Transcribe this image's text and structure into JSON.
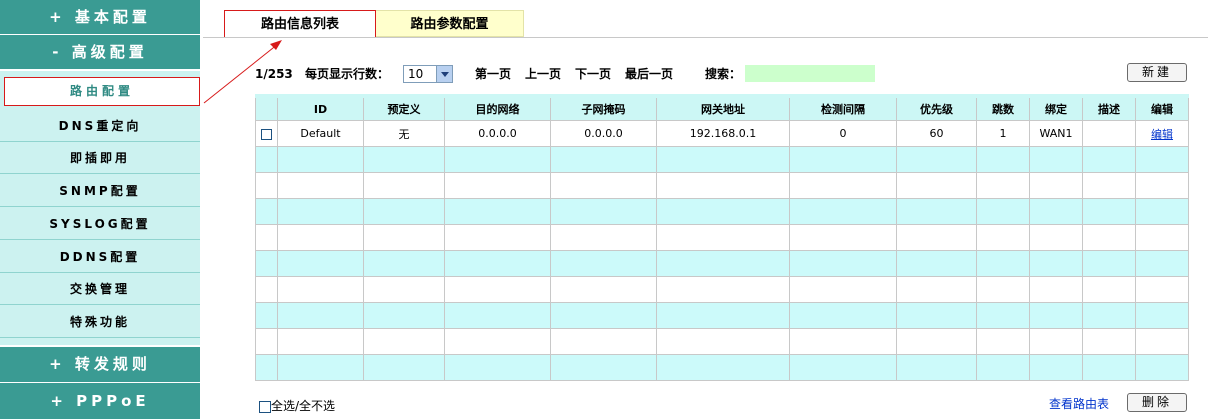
{
  "sidebar": {
    "basic": "+ 基本配置",
    "advanced": "- 高级配置",
    "items": [
      {
        "label": "路由配置"
      },
      {
        "label": "DNS重定向"
      },
      {
        "label": "即插即用"
      },
      {
        "label": "SNMP配置"
      },
      {
        "label": "SYSLOG配置"
      },
      {
        "label": "DDNS配置"
      },
      {
        "label": "交换管理"
      },
      {
        "label": "特殊功能"
      }
    ],
    "forwarding": "+ 转发规则",
    "pppoe": "+ PPPoE"
  },
  "tabs": {
    "list": "路由信息列表",
    "params": "路由参数配置"
  },
  "toolbar": {
    "page_info": "1/253",
    "rows_label": "每页显示行数：",
    "rows_value": "10",
    "first": "第一页",
    "prev": "上一页",
    "next": "下一页",
    "last": "最后一页",
    "search_label": "搜索：",
    "search_value": "",
    "new_button": "新建"
  },
  "table": {
    "headers": [
      "",
      "ID",
      "预定义",
      "目的网络",
      "子网掩码",
      "网关地址",
      "检测间隔",
      "优先级",
      "跳数",
      "绑定",
      "描述",
      "编辑"
    ],
    "rows": [
      {
        "id": "Default",
        "predefined": "无",
        "dest": "0.0.0.0",
        "mask": "0.0.0.0",
        "gateway": "192.168.0.1",
        "interval": "0",
        "priority": "60",
        "hops": "1",
        "bind": "WAN1",
        "desc": "",
        "edit": "编辑"
      }
    ]
  },
  "footer": {
    "select_all": "全选/全不选",
    "view_routes": "查看路由表",
    "delete_button": "删除"
  },
  "colors": {
    "sidebar_main": "#3a9b93",
    "sidebar_sub": "#ccf2f0",
    "table_header": "#ccf7f5",
    "row_cyan": "#ccfafa",
    "search_bg": "#ccffcc",
    "tab_params_bg": "#ffffcc",
    "highlight_red": "#d71a1a",
    "link_blue": "#0033cc"
  }
}
